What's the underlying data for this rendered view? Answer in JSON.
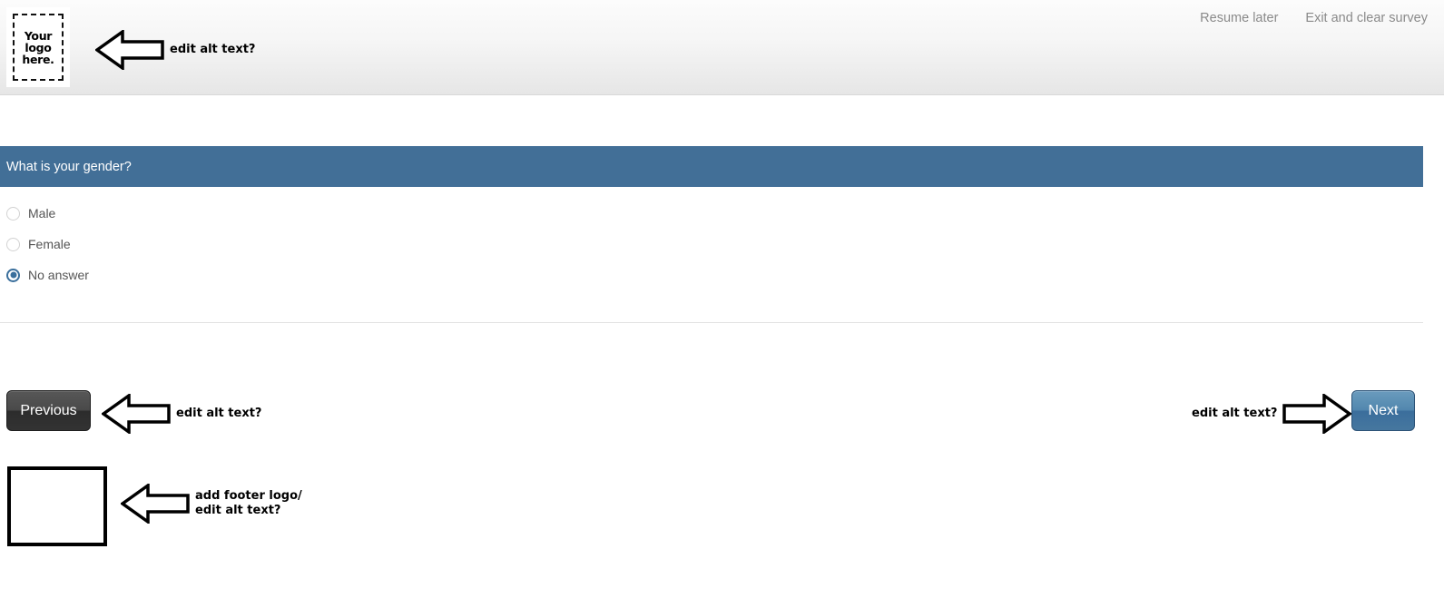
{
  "page": {
    "title": "Survey page with annotation callouts"
  },
  "header": {
    "logo": {
      "alt_placeholder_lines": [
        "Your",
        "logo",
        "here."
      ],
      "icon": "logo-placeholder-icon"
    },
    "links": [
      {
        "label": "Resume later"
      },
      {
        "label": "Exit and clear survey"
      }
    ],
    "annotation": {
      "text": "edit alt text?",
      "arrow_direction": "left",
      "icon": "arrow-left-icon"
    }
  },
  "question": {
    "text": "What is your gender?",
    "bar_color": "#426f97",
    "options": [
      {
        "label": "Male",
        "selected": false
      },
      {
        "label": "Female",
        "selected": false
      },
      {
        "label": "No answer",
        "selected": true
      }
    ]
  },
  "navigation": {
    "previous": {
      "label": "Previous",
      "color": "#3a3a3a",
      "annotation": {
        "text": "edit alt text?",
        "arrow_direction": "left",
        "icon": "arrow-left-icon"
      }
    },
    "next": {
      "label": "Next",
      "color": "#4a7ea6",
      "annotation": {
        "text": "edit alt text?",
        "arrow_direction": "right",
        "icon": "arrow-right-icon"
      }
    }
  },
  "footer": {
    "logo_box": {
      "label": "",
      "icon": "empty-logo-box-icon"
    },
    "annotation": {
      "text": "add footer logo/\nedit alt text?",
      "arrow_direction": "left",
      "icon": "arrow-left-icon"
    }
  }
}
